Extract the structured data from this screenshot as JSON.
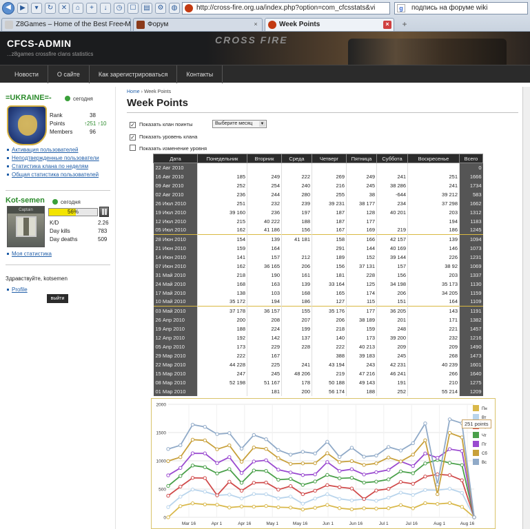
{
  "browser": {
    "url": "http://cross-fire.org.ua/index.php?option=com_cfcsstats&vi",
    "search_text": "подпись на форуме wiki",
    "tabs": [
      {
        "label": "Z8Games – Home of the Best Free MM..."
      },
      {
        "label": "Форум"
      },
      {
        "label": "Week Points"
      }
    ]
  },
  "site": {
    "title": "CFCS-ADMIN",
    "subtitle": "...z8games crossfire clans statistics",
    "logo": "CROSS FIRE",
    "nav": [
      "Новости",
      "О сайте",
      "Как зарегистрироваться",
      "Контакты"
    ]
  },
  "clan": {
    "name": "=UKRAINE=-",
    "status": "сегодня",
    "rank_label": "Rank",
    "rank_value": "38",
    "points_label": "Points",
    "points_value": "↑251 ↑10",
    "members_label": "Members",
    "members_value": "96",
    "links": [
      "Активация пользователей",
      "Неподтвержденные пользователи",
      "Статистика клана по неделям",
      "Общая статистика пользователей"
    ]
  },
  "player": {
    "name": "Kot-semen",
    "status": "сегодня",
    "avatar_caption": "Captain",
    "xp_percent": 56,
    "xp_label": "56%",
    "kd_label": "K/D",
    "kd_value": "2.26",
    "kills_label": "Day kills",
    "kills_value": "783",
    "deaths_label": "Day deaths",
    "deaths_value": "509",
    "link": "Моя статистика",
    "greeting": "Здравствуйте, kotsemen",
    "profile_link": "Profile",
    "logout": "выйти"
  },
  "main": {
    "breadcrumb_home": "Home",
    "breadcrumb_sep": "›",
    "breadcrumb_current": "Week Points",
    "title": "Week Points",
    "opt_clan_points": "Показать клан поинты",
    "month_select": "Выберите месяц",
    "opt_clan_level": "Показать уровень клана",
    "opt_level_change": "Показать изменение уровня"
  },
  "table": {
    "headers": [
      "Дата",
      "Понедельник",
      "Вторник",
      "Среда",
      "Четверг",
      "Пятница",
      "Суббота",
      "Воскресенье",
      "Всего"
    ],
    "rows": [
      [
        "22 Авг 2010",
        "",
        "",
        "",
        "",
        "",
        "",
        "",
        "0"
      ],
      [
        "16 Авг 2010",
        "185",
        "249",
        "222",
        "269",
        "249",
        "241",
        "251",
        "1666"
      ],
      [
        "09 Авг 2010",
        "252",
        "254",
        "240",
        "216",
        "245",
        "38 286",
        "241",
        "1734"
      ],
      [
        "02 Авг 2010",
        "236",
        "244",
        "280",
        "255",
        "38",
        "-644",
        "39 212",
        "583"
      ],
      [
        "26 Июл 2010",
        "251",
        "232",
        "239",
        "39 231",
        "38 177",
        "234",
        "37 298",
        "1662"
      ],
      [
        "19 Июл 2010",
        "39 160",
        "236",
        "197",
        "187",
        "128",
        "40 201",
        "203",
        "1312"
      ],
      [
        "12 Июл 2010",
        "215",
        "40 222",
        "188",
        "187",
        "177",
        "",
        "194",
        "1183"
      ],
      [
        "05 Июл 2010",
        "162",
        "41 186",
        "156",
        "167",
        "169",
        "219",
        "186",
        "1245"
      ],
      [
        "28 Июн 2010",
        "154",
        "139",
        "41 181",
        "158",
        "166",
        "42 157",
        "139",
        "1094"
      ],
      [
        "21 Июн 2010",
        "159",
        "164",
        "",
        "291",
        "144",
        "40 169",
        "146",
        "1073"
      ],
      [
        "14 Июн 2010",
        "141",
        "157",
        "212",
        "189",
        "152",
        "39 144",
        "226",
        "1231"
      ],
      [
        "07 Июн 2010",
        "162",
        "36 165",
        "206",
        "156",
        "37 131",
        "157",
        "38 92",
        "1069"
      ],
      [
        "31 Май 2010",
        "218",
        "190",
        "161",
        "181",
        "228",
        "156",
        "203",
        "1337"
      ],
      [
        "24 Май 2010",
        "168",
        "163",
        "139",
        "33 164",
        "125",
        "34 198",
        "35 173",
        "1130"
      ],
      [
        "17 Май 2010",
        "138",
        "103",
        "168",
        "165",
        "174",
        "206",
        "34 205",
        "1159"
      ],
      [
        "10 Май 2010",
        "35 172",
        "194",
        "186",
        "127",
        "115",
        "151",
        "164",
        "1109"
      ],
      [
        "03 Май 2010",
        "37 178",
        "36 157",
        "155",
        "35 176",
        "177",
        "36 205",
        "143",
        "1191"
      ],
      [
        "26 Апр 2010",
        "200",
        "208",
        "207",
        "206",
        "38 189",
        "201",
        "171",
        "1382"
      ],
      [
        "19 Апр 2010",
        "188",
        "224",
        "199",
        "218",
        "159",
        "248",
        "221",
        "1457"
      ],
      [
        "12 Апр 2010",
        "192",
        "142",
        "137",
        "140",
        "173",
        "39 200",
        "232",
        "1216"
      ],
      [
        "05 Апр 2010",
        "173",
        "229",
        "228",
        "222",
        "40 213",
        "209",
        "209",
        "1490"
      ],
      [
        "29 Мар 2010",
        "222",
        "167",
        "",
        "388",
        "39 183",
        "245",
        "268",
        "1473"
      ],
      [
        "22 Мар 2010",
        "44 228",
        "225",
        "241",
        "43 194",
        "243",
        "42 231",
        "40 239",
        "1601"
      ],
      [
        "15 Мар 2010",
        "247",
        "245",
        "48 206",
        "219",
        "47 216",
        "46 241",
        "266",
        "1640"
      ],
      [
        "08 Мар 2010",
        "52 198",
        "51 167",
        "178",
        "50 188",
        "49 143",
        "191",
        "210",
        "1275"
      ],
      [
        "01 Мар 2010",
        "",
        "181",
        "200",
        "56 174",
        "188",
        "252",
        "55 214",
        "1209"
      ]
    ]
  },
  "chart_data": {
    "type": "line",
    "x": [
      "01 Мар",
      "08 Мар",
      "15 Мар",
      "22 Мар",
      "29 Мар",
      "05 Апр",
      "12 Апр",
      "19 Апр",
      "26 Апр",
      "03 Май",
      "10 Май",
      "17 Май",
      "24 Май",
      "31 Май",
      "07 Июн",
      "14 Июн",
      "21 Июн",
      "28 Июн",
      "05 Июл",
      "12 Июл",
      "19 Июл",
      "26 Июл",
      "02 Авг",
      "09 Авг",
      "16 Авг",
      "22 Авг"
    ],
    "x_ticks": [
      "Mar 16",
      "Apr 1",
      "Apr 16",
      "May 1",
      "May 16",
      "Jun 1",
      "Jun 16",
      "Jul 1",
      "Jul 16",
      "Aug 1",
      "Aug 16"
    ],
    "ylim": [
      0,
      2000
    ],
    "y_ticks": [
      0,
      500,
      1000,
      1500,
      2000
    ],
    "tooltip": "251 points",
    "legend": [
      "Пн",
      "Вт",
      "Ср",
      "Чт",
      "Пт",
      "Сб",
      "Вс"
    ],
    "series_colors": [
      "#d9b84a",
      "#b8d4ec",
      "#d04a4a",
      "#4aa04a",
      "#9a4ad0",
      "#c8a03a",
      "#90aac8"
    ],
    "series": [
      {
        "name": "Пн",
        "values": [
          0,
          198,
          247,
          228,
          222,
          173,
          192,
          188,
          200,
          178,
          172,
          138,
          168,
          218,
          162,
          141,
          159,
          154,
          162,
          215,
          160,
          251,
          236,
          252,
          185,
          0
        ]
      },
      {
        "name": "Вт",
        "values": [
          181,
          365,
          492,
          453,
          389,
          402,
          334,
          412,
          408,
          335,
          366,
          241,
          331,
          408,
          327,
          298,
          323,
          293,
          348,
          437,
          396,
          483,
          480,
          506,
          434,
          0
        ]
      },
      {
        "name": "Ср",
        "values": [
          381,
          543,
          698,
          694,
          389,
          630,
          471,
          611,
          615,
          490,
          552,
          409,
          470,
          569,
          533,
          510,
          323,
          474,
          504,
          625,
          593,
          722,
          760,
          746,
          656,
          0
        ]
      },
      {
        "name": "Чт",
        "values": [
          555,
          731,
          917,
          888,
          777,
          852,
          611,
          829,
          821,
          666,
          679,
          574,
          634,
          750,
          689,
          699,
          614,
          632,
          671,
          812,
          780,
          953,
          1015,
          962,
          925,
          0
        ]
      },
      {
        "name": "Пт",
        "values": [
          743,
          874,
          1133,
          1131,
          960,
          1065,
          784,
          988,
          1010,
          843,
          794,
          748,
          759,
          978,
          820,
          851,
          758,
          798,
          840,
          989,
          908,
          1130,
          1053,
          1207,
          1174,
          0
        ]
      },
      {
        "name": "Сб",
        "values": [
          995,
          1065,
          1374,
          1362,
          1205,
          1274,
          984,
          1236,
          1211,
          1048,
          945,
          954,
          957,
          1134,
          977,
          995,
          927,
          955,
          1059,
          989,
          1109,
          1364,
          409,
          1493,
          1415,
          0
        ]
      },
      {
        "name": "Вс",
        "values": [
          1209,
          1275,
          1640,
          1601,
          1473,
          1490,
          1216,
          1457,
          1382,
          1191,
          1109,
          1159,
          1130,
          1337,
          1069,
          1231,
          1073,
          1094,
          1245,
          1183,
          1312,
          1662,
          583,
          1734,
          1666,
          0
        ]
      }
    ]
  }
}
